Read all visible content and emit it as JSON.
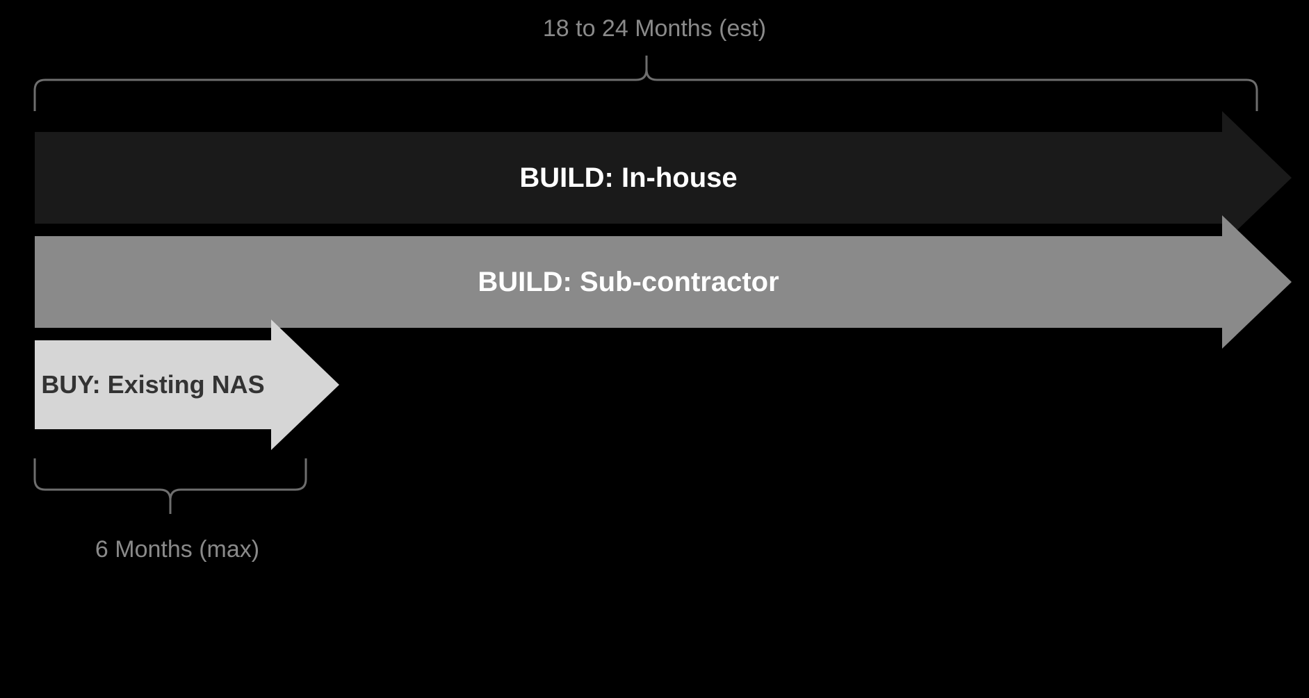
{
  "top_timeframe_label": "18 to 24 Months (est)",
  "bottom_timeframe_label": "6 Months (max)",
  "arrows": {
    "build_inhouse": {
      "label": "BUILD: In-house"
    },
    "build_subcontractor": {
      "label": "BUILD: Sub-contractor"
    },
    "buy_existing_nas": {
      "label": "BUY: Existing NAS"
    }
  },
  "chart_data": {
    "type": "bar",
    "orientation": "horizontal",
    "unit": "months",
    "top_bracket": {
      "label": "18 to 24 Months (est)",
      "range_min": 18,
      "range_max": 24,
      "applies_to": [
        "BUILD: In-house",
        "BUILD: Sub-contractor"
      ]
    },
    "bottom_bracket": {
      "label": "6 Months (max)",
      "max": 6,
      "applies_to": [
        "BUY: Existing NAS"
      ]
    },
    "series": [
      {
        "name": "BUILD: In-house",
        "duration_months_min": 18,
        "duration_months_max": 24,
        "color": "#1a1a1a"
      },
      {
        "name": "BUILD: Sub-contractor",
        "duration_months_min": 18,
        "duration_months_max": 24,
        "color": "#8a8a8a"
      },
      {
        "name": "BUY: Existing NAS",
        "duration_months_max": 6,
        "color": "#d6d6d6"
      }
    ]
  }
}
